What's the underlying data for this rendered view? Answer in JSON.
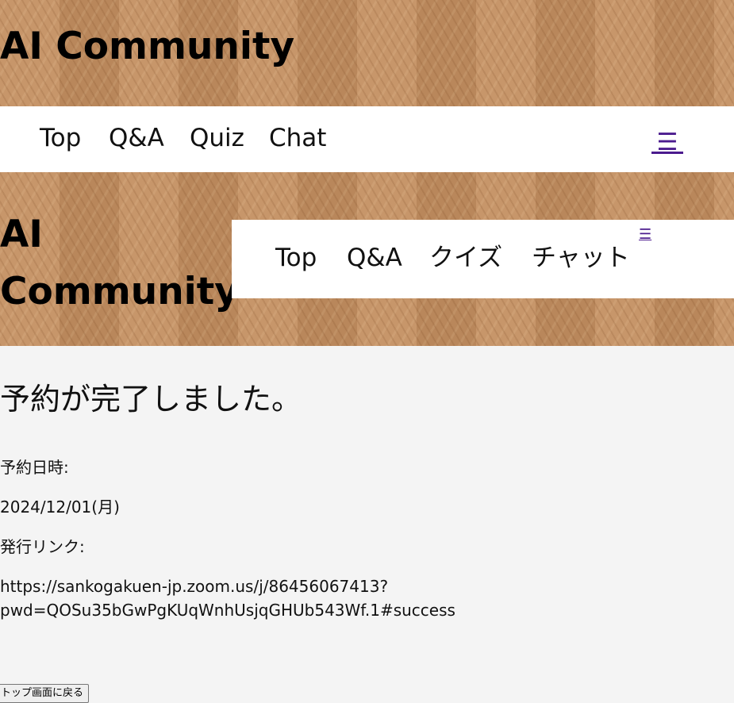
{
  "header_top": {
    "site_title": "AI Community",
    "nav": [
      "Top",
      "Q&A",
      "Quiz",
      "Chat"
    ],
    "menu_icon": "☰"
  },
  "header_mid": {
    "site_title": "AI Community",
    "nav": [
      "Top",
      "Q&A",
      "クイズ",
      "チャット"
    ],
    "menu_icon": "☰"
  },
  "main": {
    "heading": "予約が完了しました。",
    "date_label": "予約日時:",
    "date_value": "2024/12/01(月)",
    "link_label": "発行リンク:",
    "link_line1": "https://sankogakuen-jp.zoom.us/j/86456067413?",
    "link_line2": "pwd=QOSu35bGwPgKUqWnhUsjqGHUb543Wf.1#success",
    "back_button": "トップ画面に戻る"
  },
  "colors": {
    "accent": "#4b1b8e",
    "content_bg": "#f4f4f4",
    "nav_bg": "#ffffff"
  }
}
